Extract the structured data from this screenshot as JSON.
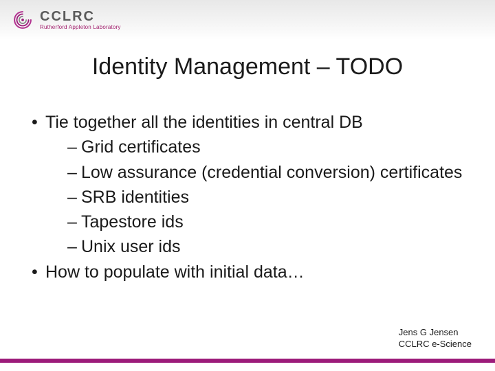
{
  "logo": {
    "main": "CCLRC",
    "sub": "Rutherford Appleton Laboratory"
  },
  "title": "Identity Management – TODO",
  "bullets": [
    {
      "text": "Tie together all the identities in central DB",
      "subs": [
        "Grid certificates",
        "Low assurance (credential conversion) certificates",
        "SRB identities",
        "Tapestore ids",
        "Unix user ids"
      ]
    },
    {
      "text": "How to populate with initial data…",
      "subs": []
    }
  ],
  "footer": {
    "author": "Jens G Jensen",
    "org": "CCLRC e-Science"
  },
  "colors": {
    "accent": "#9c1b7a"
  }
}
